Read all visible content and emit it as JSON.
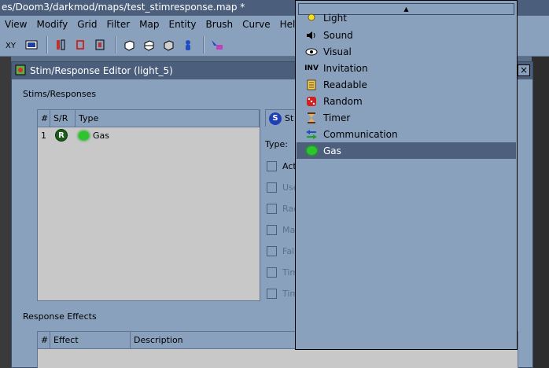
{
  "window": {
    "title": "es/Doom3/darkmod/maps/test_stimresponse.map *",
    "menu": [
      "View",
      "Modify",
      "Grid",
      "Filter",
      "Map",
      "Entity",
      "Brush",
      "Curve",
      "Help"
    ]
  },
  "toolbar": {
    "icons": [
      "xy-view-icon",
      "camera-icon",
      "flip-x-icon",
      "flip-y-icon",
      "flip-z-icon",
      "cube-icon",
      "cube-clip-icon",
      "cube-select-icon",
      "entity-icon",
      "select-tool-icon"
    ]
  },
  "dialog": {
    "title": "Stim/Response Editor (light_5)",
    "close_label": "×",
    "stims_responses_label": "Stims/Responses",
    "list_headers": [
      "#",
      "S/R",
      "Type"
    ],
    "rows": [
      {
        "num": "1",
        "sr": "R",
        "type": "Gas"
      }
    ],
    "stim_tab_label": "St",
    "type_label": "Type:",
    "checkboxes": [
      {
        "label": "Acti",
        "enabled": true
      },
      {
        "label": "Use",
        "enabled": false
      },
      {
        "label": "Rad",
        "enabled": false
      },
      {
        "label": "Mag",
        "enabled": false
      },
      {
        "label": "Fall",
        "enabled": false
      },
      {
        "label": "Tim",
        "enabled": false
      },
      {
        "label": "Tim",
        "enabled": false
      }
    ],
    "response_effects_label": "Response Effects",
    "effects_headers": [
      "#",
      "Effect",
      "Description"
    ]
  },
  "dropdown": {
    "scroll_up_glyph": "▲",
    "items": [
      {
        "label": "Light",
        "icon": "light-bulb-icon"
      },
      {
        "label": "Sound",
        "icon": "speaker-icon"
      },
      {
        "label": "Visual",
        "icon": "eye-icon"
      },
      {
        "label": "Invitation",
        "icon": "inv-icon",
        "icon_text": "INV"
      },
      {
        "label": "Readable",
        "icon": "document-icon"
      },
      {
        "label": "Random",
        "icon": "dice-icon"
      },
      {
        "label": "Timer",
        "icon": "hourglass-icon"
      },
      {
        "label": "Communication",
        "icon": "arrows-icon"
      },
      {
        "label": "Gas",
        "icon": "gas-cloud-icon",
        "selected": true
      }
    ]
  },
  "colors": {
    "accent": "#4b5f7c",
    "panel": "#8aa1bd",
    "selection": "#4d5f7c"
  }
}
